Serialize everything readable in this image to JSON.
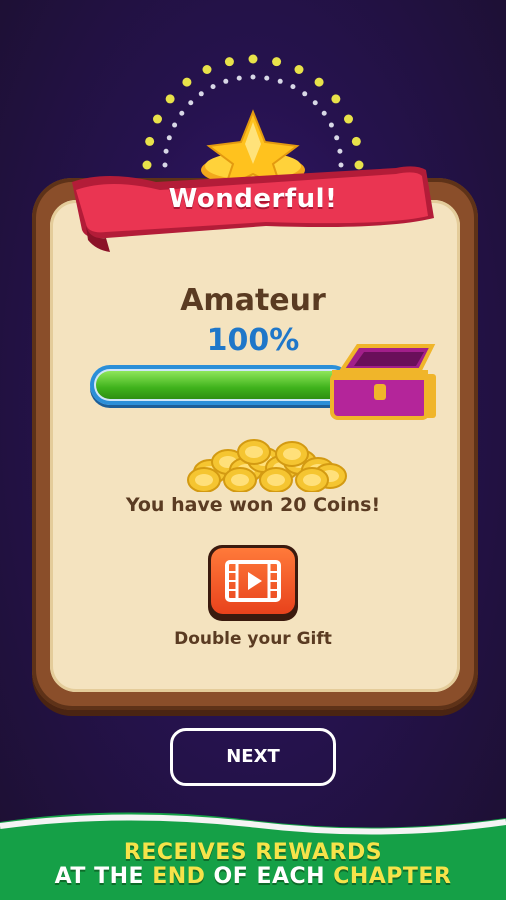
{
  "popup": {
    "ribbon_title": "Wonderful!",
    "rank_title": "Amateur",
    "progress_text": "100%",
    "progress_fraction": 1.0,
    "reward_text": "You have won 20 Coins!",
    "video_button_icon": "video-play-icon",
    "double_gift_label": "Double your Gift"
  },
  "next_button_label": "NEXT",
  "promo_banner": {
    "line1": "RECEIVES REWARDS",
    "line2_part1": "AT THE ",
    "line2_highlight1": "END",
    "line2_part2": " OF EACH ",
    "line2_highlight2": "CHAPTER"
  },
  "colors": {
    "background": "#26124f",
    "panel_frame": "#8a4e2a",
    "panel_fill": "#f4e3bf",
    "ribbon": "#e8334f",
    "percent_text": "#1f77c9",
    "progress_fill": "#3fb21c",
    "banner_green": "#16a34a",
    "banner_yellow": "#f6e34a"
  }
}
